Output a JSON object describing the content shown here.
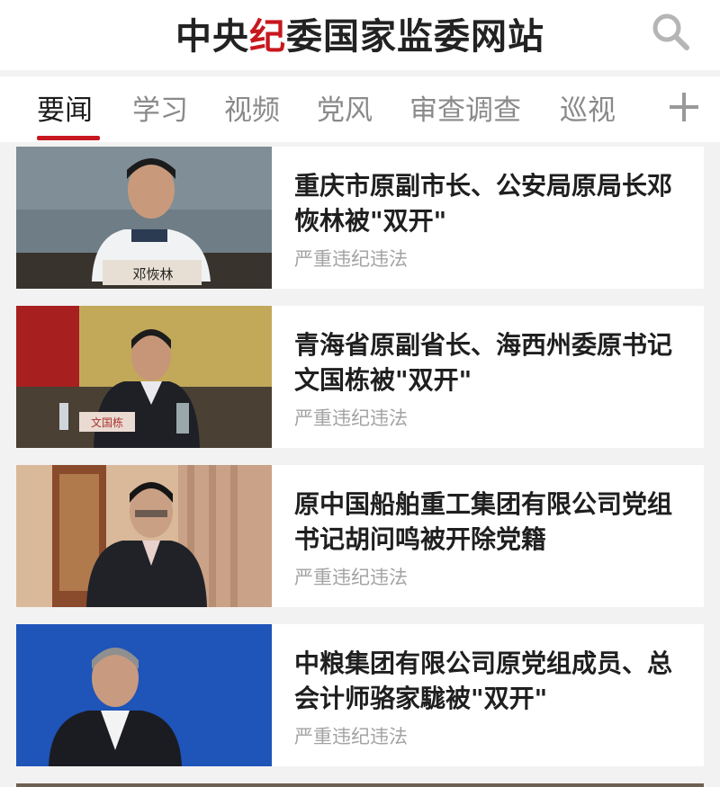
{
  "header": {
    "title_part1": "中央",
    "title_accent": "纪",
    "title_part2": "委国家监委网站",
    "accent_color": "#c8171e"
  },
  "tabs": [
    {
      "label": "要闻",
      "active": true
    },
    {
      "label": "学习",
      "active": false
    },
    {
      "label": "视频",
      "active": false
    },
    {
      "label": "党风",
      "active": false
    },
    {
      "label": "审查调查",
      "active": false
    },
    {
      "label": "巡视",
      "active": false
    }
  ],
  "articles": [
    {
      "title": "重庆市原副市长、公安局原局长邓恢林被\"双开\"",
      "tag": "严重违纪违法",
      "nameplate": "邓恢林"
    },
    {
      "title": "青海省原副省长、海西州委原书记文国栋被\"双开\"",
      "tag": "严重违纪违法",
      "nameplate": "文国栋"
    },
    {
      "title": "原中国船舶重工集团有限公司党组书记胡问鸣被开除党籍",
      "tag": "严重违纪违法"
    },
    {
      "title": "中粮集团有限公司原党组成员、总会计师骆家駹被\"双开\"",
      "tag": "严重违纪违法"
    }
  ]
}
